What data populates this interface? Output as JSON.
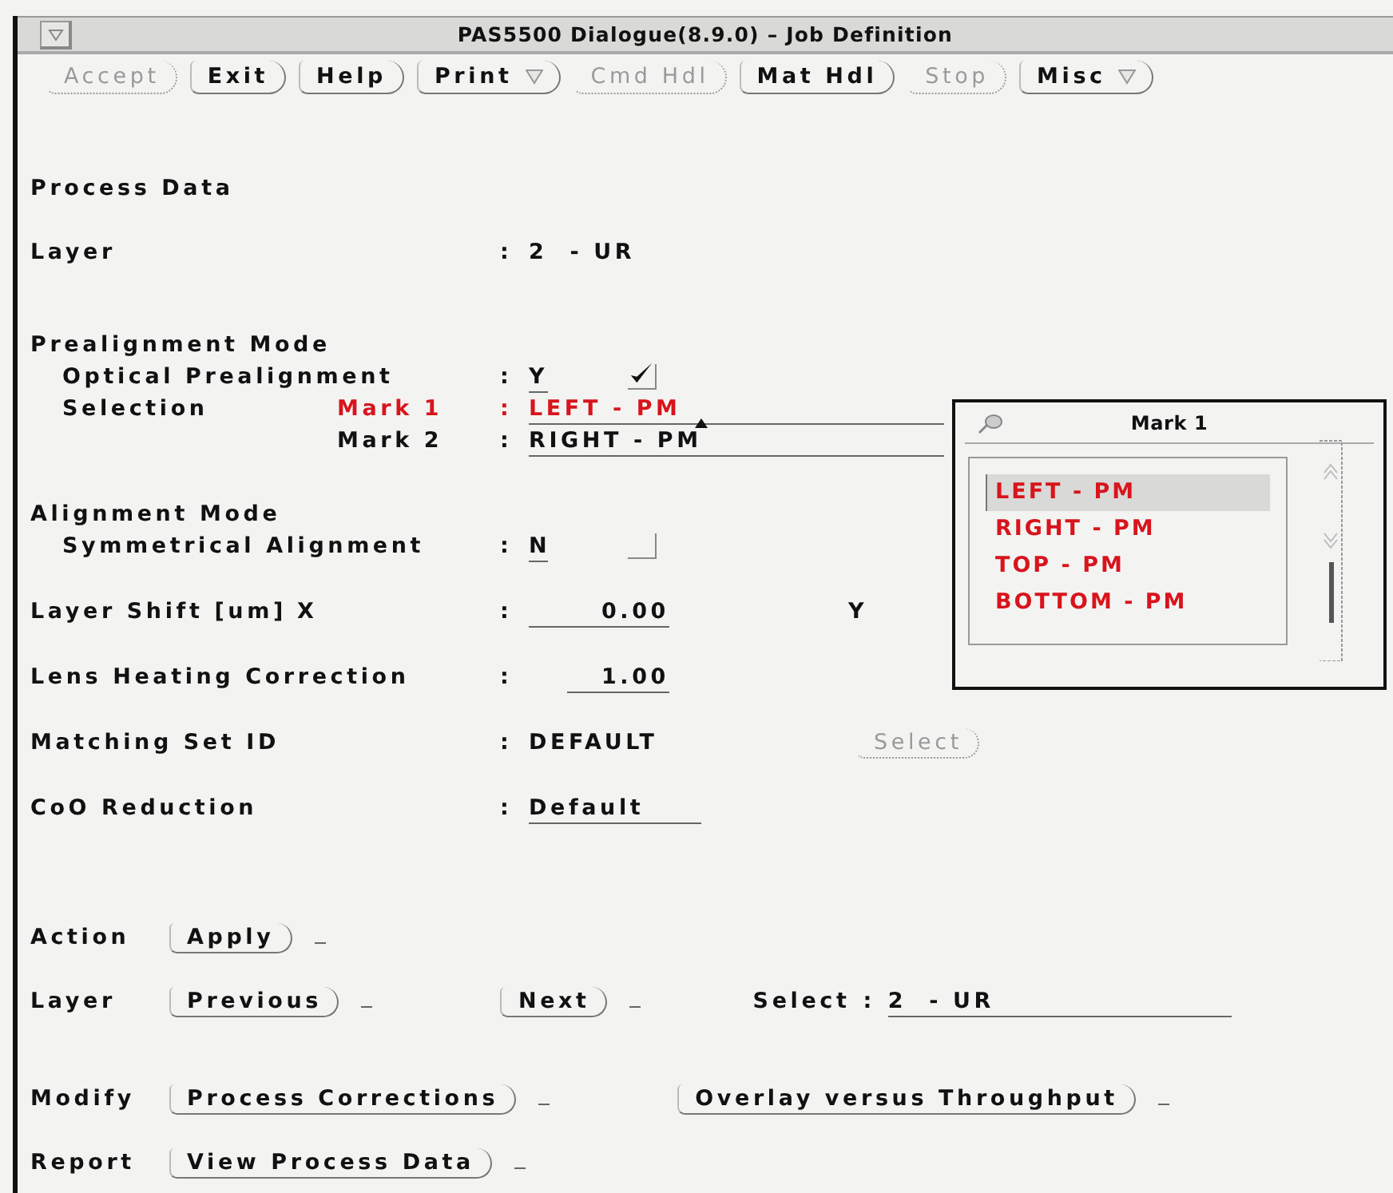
{
  "window": {
    "title": "PAS5500 Dialogue(8.9.0) – Job Definition"
  },
  "toolbar": [
    {
      "label": "Accept",
      "disabled": true,
      "kind": "button"
    },
    {
      "label": "Exit",
      "disabled": false,
      "kind": "button"
    },
    {
      "label": "Help",
      "disabled": false,
      "kind": "button"
    },
    {
      "label": "Print",
      "disabled": false,
      "kind": "menu"
    },
    {
      "label": "Cmd Hdl",
      "disabled": true,
      "kind": "button"
    },
    {
      "label": "Mat Hdl",
      "disabled": false,
      "kind": "button"
    },
    {
      "label": "Stop",
      "disabled": true,
      "kind": "button"
    },
    {
      "label": "Misc",
      "disabled": false,
      "kind": "menu"
    }
  ],
  "process_data": {
    "heading": "Process Data",
    "layer": {
      "label": "Layer",
      "sep": ":",
      "value": "2  - UR"
    },
    "prealignment": {
      "heading": "Prealignment Mode",
      "optical": {
        "label": "Optical Prealignment",
        "sep": ":",
        "value": "Y",
        "checked": true
      },
      "selection": {
        "label": "Selection",
        "marks": [
          {
            "label": "Mark 1",
            "sep": ":",
            "value": "LEFT - PM",
            "selected": true
          },
          {
            "label": "Mark 2",
            "sep": ":",
            "value": "RIGHT - PM",
            "selected": false
          }
        ]
      }
    },
    "alignment": {
      "heading": "Alignment Mode",
      "symmetrical": {
        "label": "Symmetrical Alignment",
        "sep": ":",
        "value": "N",
        "checked": false
      }
    },
    "layer_shift": {
      "label": "Layer Shift [um]",
      "x_label": "X",
      "sep": ":",
      "x_value": "0.00",
      "y_label": "Y"
    },
    "lens_heating": {
      "label": "Lens Heating Correction",
      "sep": ":",
      "value": "1.00"
    },
    "matching_set": {
      "label": "Matching Set ID",
      "sep": ":",
      "value": "DEFAULT",
      "button": {
        "label": "Select",
        "disabled": true
      }
    },
    "coo": {
      "label": "CoO Reduction",
      "sep": ":",
      "value": "Default"
    }
  },
  "actions": [
    {
      "label": "Action",
      "buttons": [
        "Apply"
      ]
    },
    {
      "label": "Layer",
      "buttons": [
        "Previous",
        "Next"
      ],
      "select": {
        "label": "Select",
        "sep": ":",
        "value": "2  - UR"
      }
    },
    {
      "label": "Modify",
      "buttons": [
        "Process Corrections",
        "Overlay versus Throughput"
      ]
    },
    {
      "label": "Report",
      "buttons": [
        "View Process Data"
      ]
    }
  ],
  "popup": {
    "title": "Mark 1",
    "items": [
      {
        "label": "LEFT - PM",
        "selected": true
      },
      {
        "label": "RIGHT - PM",
        "selected": false
      },
      {
        "label": "TOP - PM",
        "selected": false
      },
      {
        "label": "BOTTOM - PM",
        "selected": false
      }
    ]
  }
}
